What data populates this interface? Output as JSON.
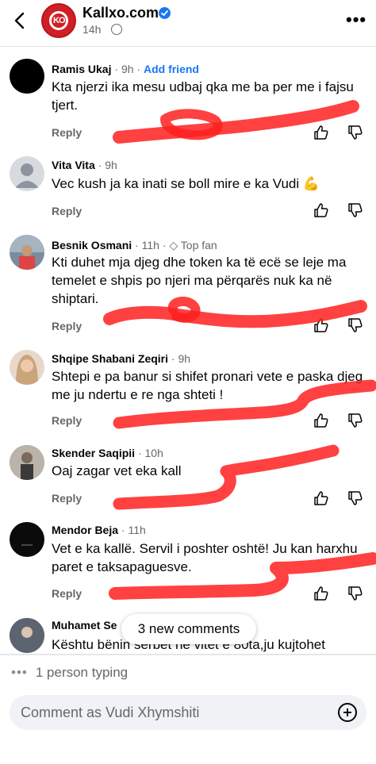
{
  "header": {
    "page_name": "Kallxo.com",
    "logo_text": "KO",
    "post_time": "14h",
    "more_label": "•••"
  },
  "comments": [
    {
      "author": "Ramis Ukaj",
      "time": "9h",
      "add_friend": "Add friend",
      "text": "Kta njerzi ika mesu udbaj qka me ba per me i fajsu tjert.",
      "reply": "Reply"
    },
    {
      "author": "Vita Vita",
      "time": "9h",
      "text": "Vec kush ja ka inati se boll mire e ka Vudi 💪",
      "reply": "Reply"
    },
    {
      "author": "Besnik Osmani",
      "time": "11h",
      "badge": "Top fan",
      "text": "Kti duhet mja djeg dhe token ka të ecë se leje ma temelet e shpis po njeri ma përqarës nuk ka në shiptari.",
      "reply": "Reply"
    },
    {
      "author": "Shqipe Shabani Zeqiri",
      "time": "9h",
      "text": "Shtepi e pa banur si shifet pronari vete e paska djeg me ju ndertu e re nga shteti !",
      "reply": "Reply"
    },
    {
      "author": "Skender Saqipii",
      "time": "10h",
      "text": "Oaj zagar vet eka kall",
      "reply": "Reply"
    },
    {
      "author": "Mendor Beja",
      "time": "11h",
      "text": "Vet e ka kallë. Servil i poshter oshtë! Ju kan harxhu paret e taksapaguesve.",
      "reply": "Reply"
    },
    {
      "author": "Muhamet Se",
      "text": "Kështu bënin serbet ne vitet e 80ta,ju kujtohet"
    }
  ],
  "new_comments_pill": "3 new comments",
  "typing_indicator": "1 person typing",
  "composer": {
    "placeholder": "Comment as Vudi Xhymshiti"
  },
  "colors": {
    "accent": "#1877f2",
    "secondary_text": "#65676b",
    "scribble": "#ff1f1f",
    "brand": "#d01f25"
  }
}
